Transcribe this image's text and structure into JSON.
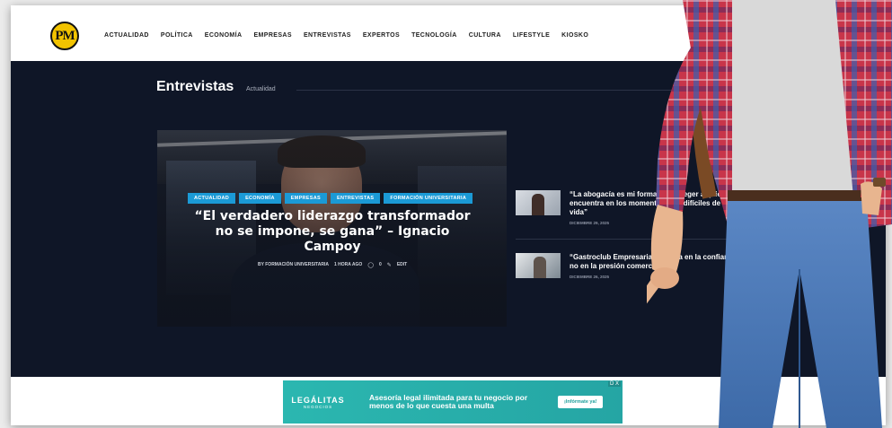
{
  "logo": {
    "text": "PM"
  },
  "nav": {
    "items": [
      "Actualidad",
      "Política",
      "Economía",
      "Empresas",
      "Entrevistas",
      "Expertos",
      "Tecnología",
      "Cultura",
      "Lifestyle",
      "Kiosko"
    ]
  },
  "section": {
    "title": "Entrevistas",
    "subtitle": "Actualidad"
  },
  "feature": {
    "tags": [
      "Actualidad",
      "Economía",
      "Empresas",
      "Entrevistas",
      "Formación Universitaria"
    ],
    "headline": "“El verdadero liderazgo transformador no se impone, se gana” – Ignacio Campoy",
    "byline": {
      "author": "By Formación Universitaria",
      "time": "1 hora ago",
      "comments": "0",
      "edit": "Edit"
    }
  },
  "side": [
    {
      "title": "“La abogacía es mi forma de proteger a quien se encuentra en los momentos más difíciles de la vida”",
      "date": "Diciembre 29, 2025"
    },
    {
      "title": "“Gastroclub Empresarial se basa en la confianza, no en la presión comercial”",
      "date": "Diciembre 26, 2025"
    }
  ],
  "ad": {
    "brand": "LEGÁLITAS",
    "brand_sub": "NEGOCIOS",
    "copy": "Asesoría legal ilimitada para tu negocio por menos de lo que cuesta una multa",
    "cta": "¡Infórmate ya!",
    "close": "D X"
  },
  "colors": {
    "accent": "#1b9ad6",
    "hero_bg": "#0f1627",
    "ad_bg": "#2bb7b0",
    "logo_bg": "#f2c300"
  }
}
